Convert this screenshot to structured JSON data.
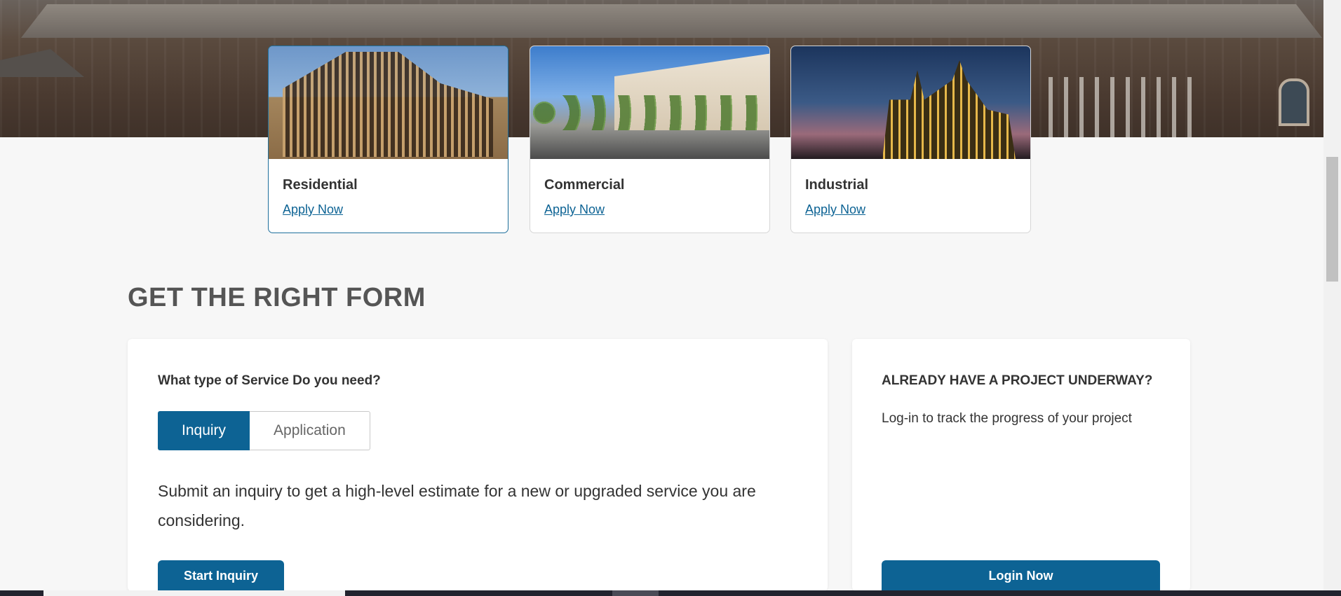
{
  "hero": {
    "cards": [
      {
        "title": "Residential",
        "link": "Apply Now"
      },
      {
        "title": "Commercial",
        "link": "Apply Now"
      },
      {
        "title": "Industrial",
        "link": "Apply Now"
      }
    ]
  },
  "section": {
    "heading": "GET THE RIGHT FORM"
  },
  "service_panel": {
    "question": "What type of Service Do you need?",
    "toggle": {
      "selected": "Inquiry",
      "options": [
        "Inquiry",
        "Application"
      ]
    },
    "description": "Submit an inquiry to get a high-level estimate for a new or upgraded service you are considering.",
    "button": "Start Inquiry"
  },
  "project_panel": {
    "title": "ALREADY HAVE A PROJECT UNDERWAY?",
    "text": "Log-in to track the progress of your project",
    "button": "Login Now"
  },
  "colors": {
    "primary": "#0d6394",
    "page_background": "#f7f7f7",
    "text": "#333333"
  }
}
